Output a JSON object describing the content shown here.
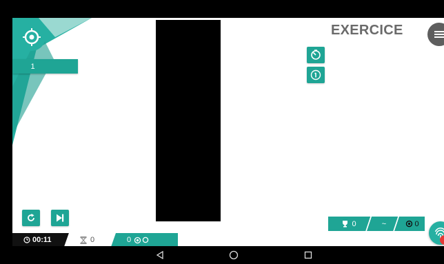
{
  "header": {
    "title": "EXERCICE"
  },
  "level": {
    "value": "1"
  },
  "timer": {
    "value": "00:11"
  },
  "bottom_bar": {
    "trials": "0",
    "score": "0"
  },
  "hud": {
    "trophy_count": "0",
    "middle": "~",
    "eyes_count": "0"
  },
  "icons": {
    "target": "target-icon",
    "menu": "menu-icon",
    "speed": "speedometer-icon",
    "info": "info-icon",
    "restart": "restart-icon",
    "skip": "skip-forward-icon",
    "clock": "clock-icon",
    "hourglass": "hourglass-icon",
    "eye": "eye-icon",
    "trophy": "trophy-icon",
    "fingerprint": "fingerprint-icon",
    "back": "back-triangle-icon",
    "home": "home-circle-icon",
    "recents": "recents-square-icon"
  },
  "colors": {
    "accent": "#1fa595",
    "light_accent": "#9ad9d1",
    "dark": "#111111",
    "title_gray": "#6a6a6a",
    "alert": "#e53935"
  }
}
